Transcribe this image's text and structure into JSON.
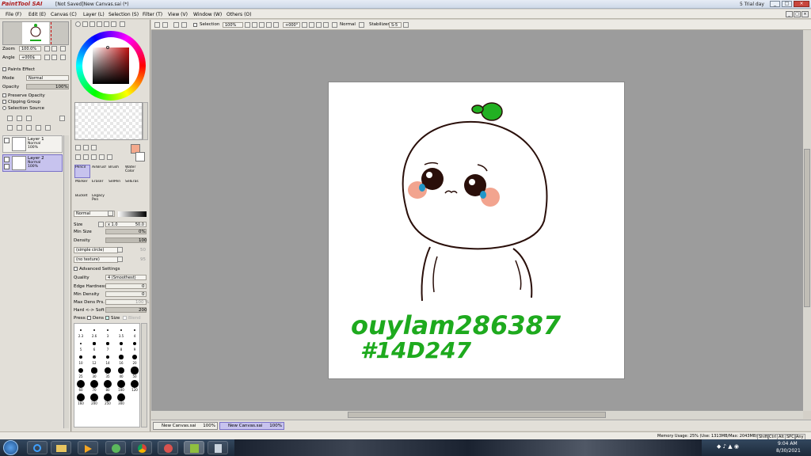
{
  "window": {
    "app_name": "PaintTool SAI",
    "title": "[Not Saved]New Canvas.sai (*)",
    "trial": "5 Trial day",
    "buttons": [
      "_",
      "□",
      "×"
    ]
  },
  "menu": [
    {
      "label": "File (F)"
    },
    {
      "label": "Edit (E)"
    },
    {
      "label": "Canvas (C)"
    },
    {
      "label": "Layer (L)"
    },
    {
      "label": "Selection (S)"
    },
    {
      "label": "Filter (T)"
    },
    {
      "label": "View (V)"
    },
    {
      "label": "Window (W)"
    },
    {
      "label": "Others (O)"
    }
  ],
  "navigator": {
    "zoom_label": "Zoom",
    "zoom_value": "100.0%",
    "angle_label": "Angle",
    "angle_value": "+000$"
  },
  "layer_panel": {
    "paints_effect": "Paints Effect",
    "mode_label": "Mode",
    "mode_value": "Normal",
    "opacity_label": "Opacity",
    "opacity_value": "100%",
    "preserve_opacity": "Preserve Opacity",
    "clipping_group": "Clipping Group",
    "selection_source": "Selection Source",
    "layers": [
      {
        "name": "Layer 1",
        "mode": "Normal",
        "opacity": "100%",
        "selected": false
      },
      {
        "name": "Layer 2",
        "mode": "Normal",
        "opacity": "100%",
        "selected": true
      }
    ]
  },
  "tools": {
    "items": [
      {
        "label": "Pencil"
      },
      {
        "label": "AirBrush"
      },
      {
        "label": "Brush"
      },
      {
        "label": "Water Color"
      },
      {
        "label": "Marker"
      },
      {
        "label": "Eraser"
      },
      {
        "label": "SelPen"
      },
      {
        "label": "SelEras"
      },
      {
        "label": "Bucket"
      },
      {
        "label": "Legacy Pen"
      }
    ],
    "blend_mode": "Normal",
    "size_label": "Size",
    "size_mult": "x 1.0",
    "size_value": "50.0",
    "min_size_label": "Min Size",
    "min_size_value": "0%",
    "density_label": "Density",
    "density_value": "100",
    "shape": "(simple circle)",
    "shape_value": "50",
    "texture": "(no texture)",
    "texture_value": "95",
    "advanced": "Advanced Settings",
    "quality_label": "Quality",
    "quality_value": "4 (Smoothest)",
    "edge_label": "Edge Hardness",
    "edge_value": "0",
    "min_density_label": "Min Density",
    "min_density_value": "0",
    "max_dens_label": "Max Dens Prs.",
    "max_dens_value": "100 %",
    "hard_soft_label": "Hard <-> Soft",
    "hard_soft_value": "200",
    "press_label": "Press:",
    "press_dens": "Dens",
    "press_size": "Size",
    "press_blend": "Blend",
    "brush_sizes": [
      "2.3",
      "2.6",
      "3",
      "3.5",
      "4",
      "5",
      "6",
      "7",
      "8",
      "9",
      "10",
      "12",
      "14",
      "16",
      "20",
      "25",
      "30",
      "35",
      "40",
      "50",
      "60",
      "70",
      "80",
      "100",
      "120",
      "160",
      "200",
      "250",
      "300"
    ]
  },
  "toolbar": {
    "selection_label": "Selection",
    "zoom_value": "100%",
    "angle_value": "+000°",
    "blend_mode": "Normal",
    "stabilizer_label": "Stabilizer",
    "stabilizer_value": "S-5"
  },
  "canvas_text": {
    "line1": "ouylam286387",
    "line2": "#14D247"
  },
  "tabs": [
    {
      "name": "New Canvas.sai",
      "zoom": "100%",
      "active": false
    },
    {
      "name": "New Canvas.sai",
      "zoom": "100%",
      "active": true
    }
  ],
  "status": {
    "memory": "Memory Usage: 25% (Use: 1313MB/Max: 2043MB)",
    "keys": [
      "Shift",
      "Ctrl",
      "Alt",
      "SPC",
      "Any"
    ]
  },
  "taskbar": {
    "time": "9:04 AM",
    "date": "8/30/2021"
  },
  "colors": {
    "current_color": "#f4a98c",
    "green_ink": "#1eaa1e",
    "outline": "#2a0f0a",
    "blush": "#f2a48f",
    "tear": "#2196c8"
  }
}
